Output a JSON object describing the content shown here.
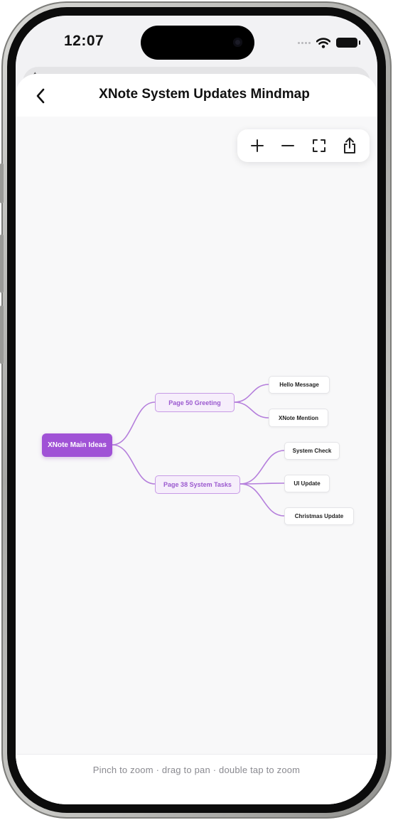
{
  "status_bar": {
    "time": "12:07"
  },
  "nav": {
    "title": "XNote System Updates Mindmap",
    "back_icon": "chevron-left-icon"
  },
  "toolbar": {
    "buttons": [
      {
        "name": "zoom-in-button",
        "icon": "plus-icon"
      },
      {
        "name": "zoom-out-button",
        "icon": "minus-icon"
      },
      {
        "name": "fit-screen-button",
        "icon": "fullscreen-icon"
      },
      {
        "name": "share-button",
        "icon": "share-icon"
      }
    ]
  },
  "mindmap": {
    "root": "XNote Main Ideas",
    "branches": [
      {
        "label": "Page 50 Greeting",
        "children": [
          "Hello Message",
          "XNote Mention"
        ]
      },
      {
        "label": "Page 38 System Tasks",
        "children": [
          "System Check",
          "UI Update",
          "Christmas Update"
        ]
      }
    ]
  },
  "hint": "Pinch to zoom · drag to pan · double tap to zoom",
  "colors": {
    "root_fill": "#a052d6",
    "branch_fill": "#f6eefb",
    "branch_text": "#9b59cf",
    "connector": "#b57fdc",
    "leaf_fill": "#ffffff"
  }
}
